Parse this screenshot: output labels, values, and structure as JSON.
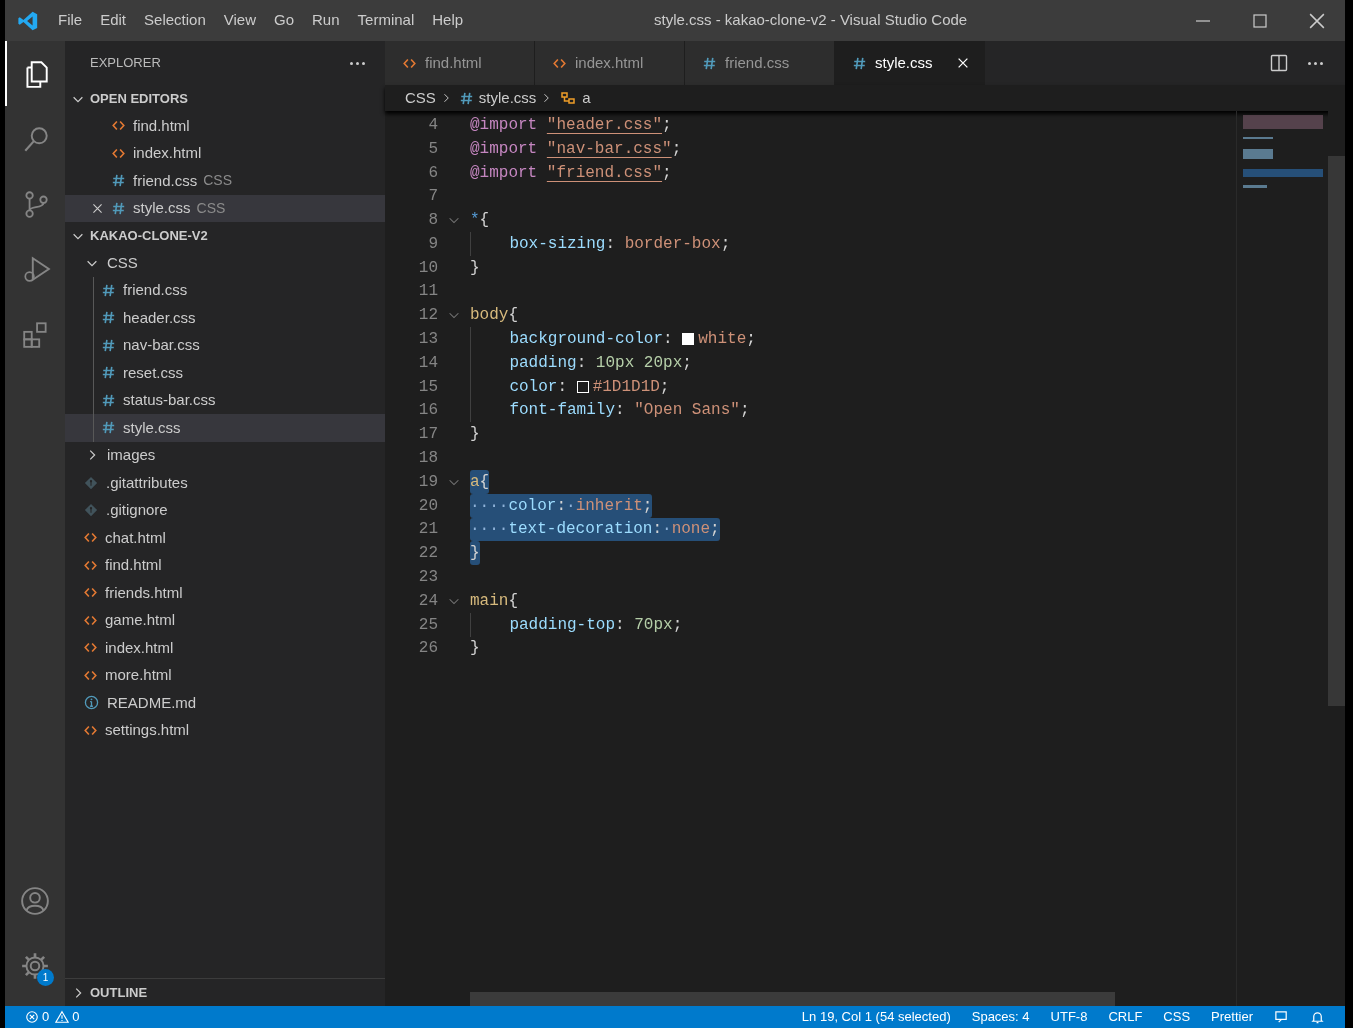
{
  "window": {
    "title": "style.css - kakao-clone-v2 - Visual Studio Code"
  },
  "menu": [
    "File",
    "Edit",
    "Selection",
    "View",
    "Go",
    "Run",
    "Terminal",
    "Help"
  ],
  "activity_bar": [
    {
      "kind": "explorer",
      "selected": true
    },
    {
      "kind": "search",
      "selected": false
    },
    {
      "kind": "source-control",
      "selected": false
    },
    {
      "kind": "debug",
      "selected": false
    },
    {
      "kind": "extensions",
      "selected": false
    }
  ],
  "activity_bottom": [
    {
      "kind": "account"
    },
    {
      "kind": "settings",
      "badge": "1"
    }
  ],
  "explorer": {
    "title": "EXPLORER",
    "open_editors": {
      "label": "OPEN EDITORS",
      "expanded": true,
      "items": [
        {
          "name": "find.html",
          "kind": "html",
          "selected": false
        },
        {
          "name": "index.html",
          "kind": "html",
          "selected": false
        },
        {
          "name": "friend.css",
          "kind": "css",
          "note": "CSS",
          "selected": false
        },
        {
          "name": "style.css",
          "kind": "css",
          "note": "CSS",
          "selected": true
        }
      ]
    },
    "project": {
      "label": "KAKAO-CLONE-V2",
      "expanded": true,
      "children": [
        {
          "name": "CSS",
          "kind": "folder",
          "expanded": true,
          "selected": false,
          "children": [
            {
              "name": "friend.css",
              "kind": "css",
              "selected": false
            },
            {
              "name": "header.css",
              "kind": "css",
              "selected": false
            },
            {
              "name": "nav-bar.css",
              "kind": "css",
              "selected": false
            },
            {
              "name": "reset.css",
              "kind": "css",
              "selected": false
            },
            {
              "name": "status-bar.css",
              "kind": "css",
              "selected": false
            },
            {
              "name": "style.css",
              "kind": "css",
              "selected": true
            }
          ]
        },
        {
          "name": "images",
          "kind": "folder",
          "expanded": false,
          "selected": false
        },
        {
          "name": ".gitattributes",
          "kind": "git",
          "selected": false
        },
        {
          "name": ".gitignore",
          "kind": "git",
          "selected": false
        },
        {
          "name": "chat.html",
          "kind": "html",
          "selected": false
        },
        {
          "name": "find.html",
          "kind": "html",
          "selected": false
        },
        {
          "name": "friends.html",
          "kind": "html",
          "selected": false
        },
        {
          "name": "game.html",
          "kind": "html",
          "selected": false
        },
        {
          "name": "index.html",
          "kind": "html",
          "selected": false
        },
        {
          "name": "more.html",
          "kind": "html",
          "selected": false
        },
        {
          "name": "README.md",
          "kind": "info",
          "selected": false
        },
        {
          "name": "settings.html",
          "kind": "html",
          "selected": false
        }
      ]
    },
    "outline": {
      "label": "OUTLINE",
      "expanded": false
    }
  },
  "tabs": [
    {
      "label": "find.html",
      "kind": "html",
      "selected": false
    },
    {
      "label": "index.html",
      "kind": "html",
      "selected": false
    },
    {
      "label": "friend.css",
      "kind": "css",
      "selected": false
    },
    {
      "label": "style.css",
      "kind": "css",
      "selected": true
    }
  ],
  "breadcrumbs": [
    {
      "label": "CSS",
      "kind": "folder"
    },
    {
      "label": "style.css",
      "kind": "css"
    },
    {
      "label": "a",
      "kind": "symbol"
    }
  ],
  "code": [
    {
      "number": "4",
      "foldable": false,
      "selected": false,
      "text": "@import \"header.css\";"
    },
    {
      "number": "5",
      "foldable": false,
      "selected": false,
      "text": "@import \"nav-bar.css\";"
    },
    {
      "number": "6",
      "foldable": false,
      "selected": false,
      "text": "@import \"friend.css\";"
    },
    {
      "number": "7",
      "foldable": false
    },
    {
      "number": "8",
      "foldable": true,
      "selected": false,
      "text": "*{"
    },
    {
      "number": "9",
      "foldable": false,
      "selected": false,
      "text": "    box-sizing: border-box;"
    },
    {
      "number": "10",
      "foldable": false,
      "selected": false,
      "text": "}"
    },
    {
      "number": "11",
      "foldable": false
    },
    {
      "number": "12",
      "foldable": true,
      "selected": false,
      "text": "body{"
    },
    {
      "number": "13",
      "foldable": false,
      "selected": false,
      "swatch": true,
      "text": "    background-color: white;"
    },
    {
      "number": "14",
      "foldable": false,
      "selected": false,
      "text": "    padding: 10px 20px;"
    },
    {
      "number": "15",
      "foldable": false,
      "selected": false,
      "swatch": true,
      "text": "    color: #1D1D1D;"
    },
    {
      "number": "16",
      "foldable": false,
      "selected": false,
      "text": "    font-family: \"Open Sans\";"
    },
    {
      "number": "17",
      "foldable": false,
      "selected": false,
      "text": "}"
    },
    {
      "number": "18",
      "foldable": false
    },
    {
      "number": "19",
      "foldable": true,
      "selected": true,
      "text": "a{"
    },
    {
      "number": "20",
      "foldable": false,
      "selected": true,
      "text": "····color:·inherit;"
    },
    {
      "number": "21",
      "foldable": false,
      "selected": true,
      "text": "····text-decoration:·none;"
    },
    {
      "number": "22",
      "foldable": false,
      "selected": true,
      "text": "}"
    },
    {
      "number": "23",
      "foldable": false
    },
    {
      "number": "24",
      "foldable": true,
      "selected": false,
      "text": "main{"
    },
    {
      "number": "25",
      "foldable": false,
      "selected": false,
      "text": "    padding-top: 70px;"
    },
    {
      "number": "26",
      "foldable": false,
      "selected": false,
      "text": "}"
    }
  ],
  "status_bar": {
    "left": [
      {
        "kind": "errors",
        "text": "0"
      },
      {
        "kind": "warnings",
        "text": "0"
      }
    ],
    "right": [
      {
        "kind": "text",
        "text": "Ln 19, Col 1 (54 selected)"
      },
      {
        "kind": "text",
        "text": "Spaces: 4"
      },
      {
        "kind": "text",
        "text": "UTF-8"
      },
      {
        "kind": "text",
        "text": "CRLF"
      },
      {
        "kind": "text",
        "text": "CSS"
      },
      {
        "kind": "text",
        "text": "Prettier"
      },
      {
        "kind": "feedback"
      },
      {
        "kind": "bell"
      }
    ]
  }
}
